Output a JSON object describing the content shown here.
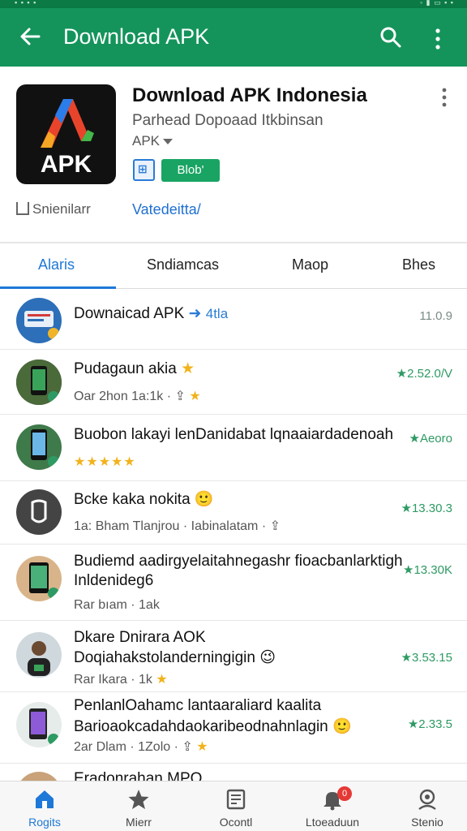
{
  "appbar": {
    "title": "Download APK"
  },
  "hero": {
    "logo_text": "APK",
    "name": "Download APK Indonesia",
    "developer": "Parhead Dopoaad Itkbinsan",
    "category": "APK",
    "install_label": "Blob'",
    "share_label": "Snienilarr",
    "visit_label": "Vatedeitta/"
  },
  "tabs": [
    {
      "label": "Alaris"
    },
    {
      "label": "Sndiamcas"
    },
    {
      "label": "Maop"
    },
    {
      "label": "Bhes"
    }
  ],
  "list": [
    {
      "title": "Downaicad APK",
      "title_suffix": "4tla",
      "value": "11.0.9",
      "value_style": "grey"
    },
    {
      "title": "Pudagaun akia",
      "sub": "Oar 2hon     1a:1k ·",
      "value": "★2.52.0/V"
    },
    {
      "title": "Buobon lakayi lenDanidabat lqnaaiardadenoah",
      "value": "★Aeoro",
      "stars": "★★★★★"
    },
    {
      "title": "Bcke kaka nokita",
      "sub": "1a: Bham    Tlanjrou · Iabinalatam ·",
      "value": "★13.30.3"
    },
    {
      "title": "Budiemd aadirgyelaitahnegashr fioacbanlarktigh",
      "title2": "Inldenideg6",
      "sub": "Rar bıam  · 1ak",
      "value": "★13.30K"
    },
    {
      "title": "Dkare Dnirara AOK",
      "title2": "Doqiahakstolanderningigin",
      "sub": "Rar Ikara  · 1k",
      "value": "★3.53.15"
    },
    {
      "title": "PenlanlOahamc lantaaraliard kaalita",
      "title2": "Barioaokcadahdaokaribeodnahnlagin",
      "sub": "2ar Dlam   · 1Zolo ·",
      "value": "★2.33.5"
    },
    {
      "title": "Eradonrahan MPO"
    }
  ],
  "bottomnav": [
    {
      "label": "Rogits",
      "active": true
    },
    {
      "label": "Mierr"
    },
    {
      "label": "Ocontl"
    },
    {
      "label": "Ltoeaduun",
      "badge": "0"
    },
    {
      "label": "Stenio"
    }
  ],
  "colors": {
    "primary": "#14945b",
    "accent": "#1e78d7",
    "install": "#19a463"
  }
}
